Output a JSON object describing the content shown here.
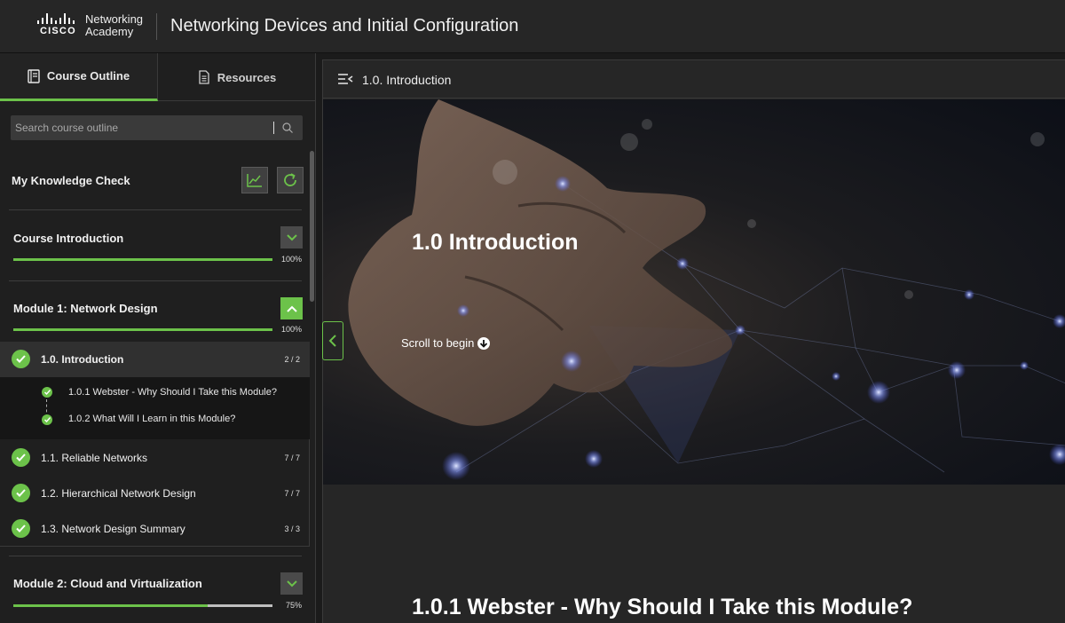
{
  "brand": {
    "logo_wordmark": "CISCO",
    "logo_line1": "Networking",
    "logo_line2": "Academy"
  },
  "course_title": "Networking Devices and Initial Configuration",
  "tabs": [
    {
      "label": "Course Outline",
      "icon": "book-icon",
      "active": true
    },
    {
      "label": "Resources",
      "icon": "document-icon",
      "active": false
    }
  ],
  "search": {
    "placeholder": "Search course outline"
  },
  "knowledge_check": {
    "label": "My Knowledge Check",
    "buttons": [
      "chart-icon",
      "refresh-icon"
    ]
  },
  "sections": {
    "intro": {
      "title": "Course Introduction",
      "progress_label": "100%",
      "progress": 1.0
    },
    "module1": {
      "title": "Module 1: Network Design",
      "progress_label": "100%",
      "progress": 1.0,
      "expanded": true
    },
    "module2": {
      "title": "Module 2: Cloud and Virtualization",
      "progress_label": "75%",
      "progress": 0.75
    }
  },
  "module1_items": [
    {
      "label": "1.0. Introduction",
      "count": "2 / 2",
      "active": true
    },
    {
      "label": "1.1. Reliable Networks",
      "count": "7 / 7"
    },
    {
      "label": "1.2. Hierarchical Network Design",
      "count": "7 / 7"
    },
    {
      "label": "1.3. Network Design Summary",
      "count": "3 / 3"
    }
  ],
  "module1_subitems": [
    {
      "label": "1.0.1 Webster - Why Should I Take this Module?"
    },
    {
      "label": "1.0.2 What Will I Learn in this Module?"
    }
  ],
  "content": {
    "header_title": "1.0. Introduction",
    "hero_title": "1.0 Introduction",
    "scroll_text": "Scroll to begin",
    "next_heading": "1.0.1 Webster - Why Should I Take this Module?"
  },
  "colors": {
    "accent": "#6cc24a",
    "background": "#1b1b1b",
    "panel": "#262626"
  }
}
